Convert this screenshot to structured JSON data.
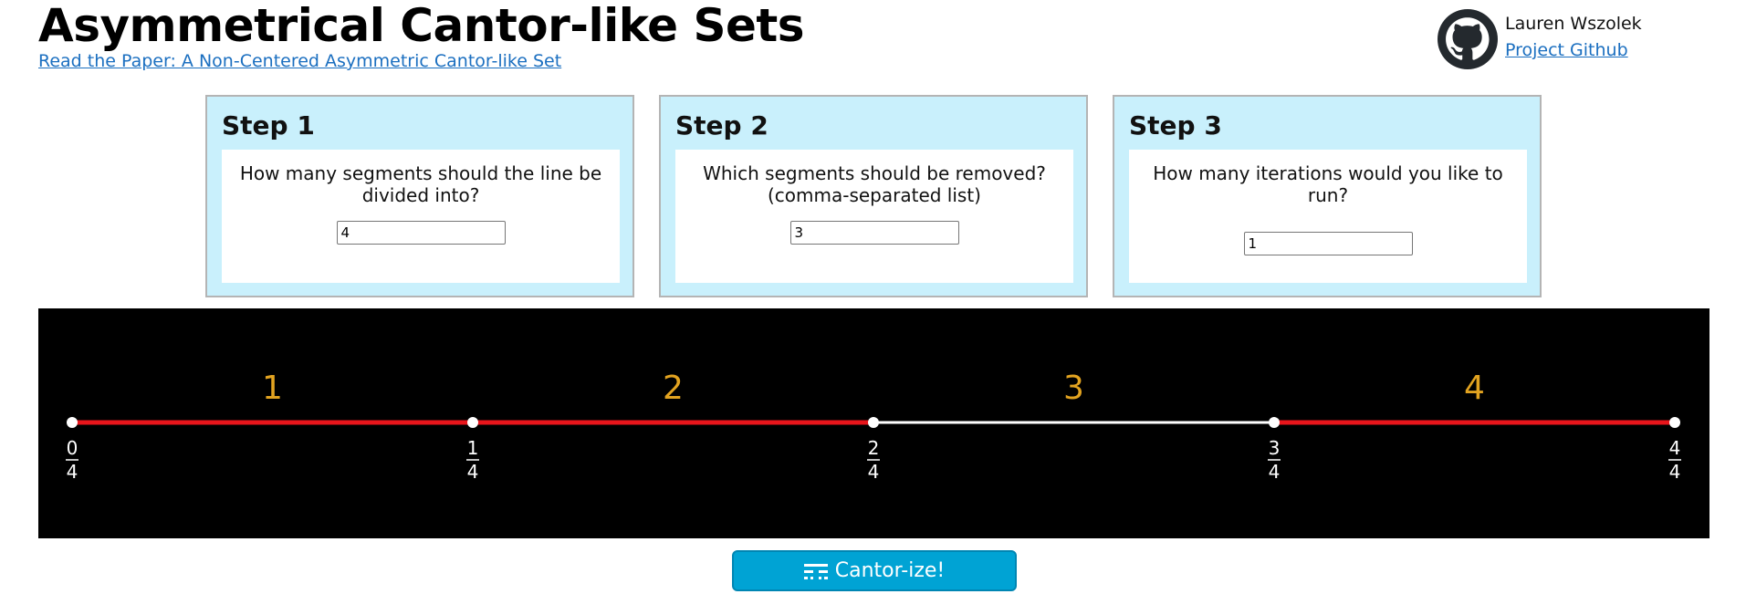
{
  "header": {
    "title": "Asymmetrical Cantor-like Sets",
    "paper_link": "Read the Paper: A Non-Centered Asymmetric Cantor-like Set"
  },
  "author": {
    "name": "Lauren Wszolek",
    "github_link": "Project Github",
    "icon": "github-icon"
  },
  "steps": [
    {
      "title": "Step 1",
      "question": "How many segments should the line be divided into?",
      "value": "4"
    },
    {
      "title": "Step 2",
      "question": "Which segments should be removed? (comma-separated list)",
      "value": "3"
    },
    {
      "title": "Step 3",
      "question": "How many iterations would you like to run?",
      "value": "1"
    }
  ],
  "visualization": {
    "segments": [
      {
        "label": "1",
        "removed": false
      },
      {
        "label": "2",
        "removed": false
      },
      {
        "label": "3",
        "removed": true
      },
      {
        "label": "4",
        "removed": false
      }
    ],
    "tick_labels": [
      {
        "num": "0",
        "den": "4"
      },
      {
        "num": "1",
        "den": "4"
      },
      {
        "num": "2",
        "den": "4"
      },
      {
        "num": "3",
        "den": "4"
      },
      {
        "num": "4",
        "den": "4"
      }
    ],
    "colors": {
      "kept": "#e8151b",
      "removed": "#ffffff",
      "label": "#e2a320",
      "background": "#000000"
    }
  },
  "button": {
    "label": "Cantor-ize!",
    "icon": "cantor-icon"
  }
}
